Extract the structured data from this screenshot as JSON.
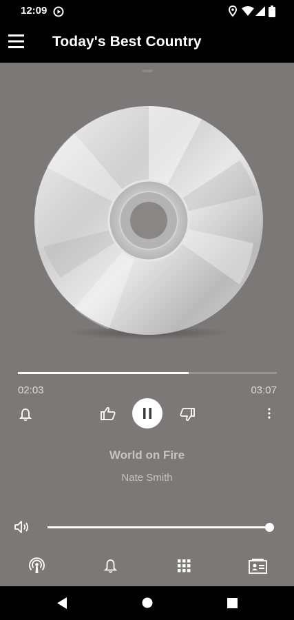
{
  "status_bar": {
    "time": "12:09",
    "icons": [
      "play-circle-icon",
      "location-icon",
      "wifi-icon",
      "signal-icon",
      "battery-icon"
    ]
  },
  "app_bar": {
    "menu_icon": "hamburger-menu-icon",
    "title": "Today's Best Country"
  },
  "player": {
    "artwork": "cd-disc-artwork",
    "progress": {
      "elapsed": "02:03",
      "duration": "03:07",
      "fraction": 0.66
    },
    "controls": [
      "bell-icon",
      "thumbs-up-icon",
      "pause-icon",
      "thumbs-down-icon",
      "more-vert-icon"
    ],
    "song": {
      "title": "World on Fire",
      "artist": "Nate Smith"
    },
    "volume": {
      "icon": "volume-icon",
      "level": 1.0
    }
  },
  "bottom_tabs": [
    "podcast-icon",
    "bell-icon",
    "grid-icon",
    "contact-card-icon"
  ],
  "system_nav": [
    "back-icon",
    "home-icon",
    "recents-icon"
  ],
  "colors": {
    "background": "#7c7877",
    "bars": "#000000",
    "text_muted": "#c7c4c3",
    "track_fill": "#ffffff",
    "track_empty": "#9a9695"
  }
}
